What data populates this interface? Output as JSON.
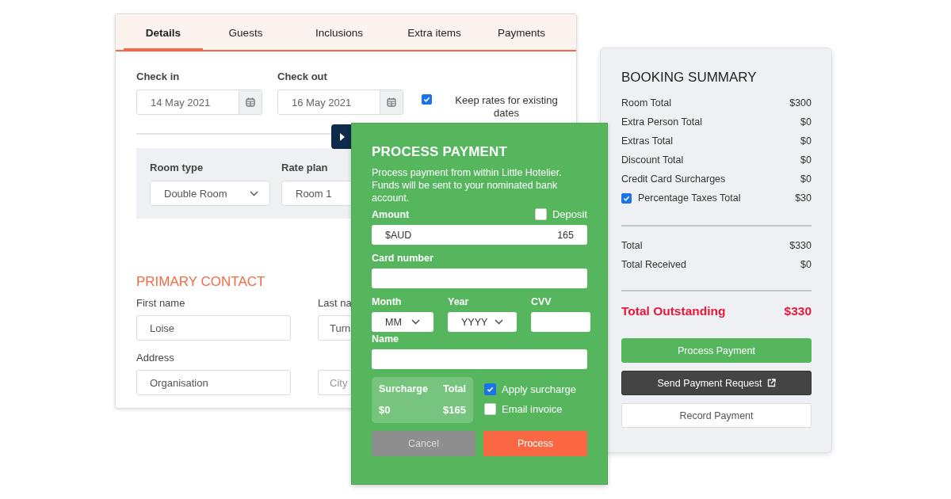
{
  "booking_form": {
    "tabs": [
      {
        "label": "Details",
        "selected": true
      },
      {
        "label": "Guests",
        "selected": false
      },
      {
        "label": "Inclusions",
        "selected": false
      },
      {
        "label": "Extra items",
        "selected": false
      },
      {
        "label": "Payments",
        "selected": false
      }
    ],
    "check_in": {
      "label": "Check in",
      "value": "14 May 2021"
    },
    "check_out": {
      "label": "Check out",
      "value": "16 May 2021"
    },
    "keep_rates": {
      "label": "Keep rates for existing dates",
      "checked": true
    },
    "room_type": {
      "label": "Room type",
      "value": "Double Room"
    },
    "rate_plan": {
      "label": "Rate plan",
      "value": "Room 1"
    },
    "primary_contact": {
      "title": "PRIMARY CONTACT",
      "first_name": {
        "label": "First name",
        "value": "Loise"
      },
      "last_name": {
        "label": "Last na",
        "value": "Turn"
      },
      "address": {
        "label": "Address",
        "value": "Organisation"
      },
      "city": {
        "placeholder": "City"
      }
    }
  },
  "payment_dialog": {
    "title": "PROCESS PAYMENT",
    "description": "Process payment from within Little Hotelier. Funds will be sent to your nominated bank account.",
    "amount": {
      "label": "Amount",
      "currency": "$AUD",
      "value": "165"
    },
    "deposit": {
      "label": "Deposit",
      "checked": false
    },
    "card_number": {
      "label": "Card number"
    },
    "month": {
      "label": "Month",
      "placeholder": "MM"
    },
    "year": {
      "label": "Year",
      "placeholder": "YYYY"
    },
    "cvv": {
      "label": "CVV"
    },
    "name": {
      "label": "Name"
    },
    "surcharge": {
      "surcharge_label": "Surcharge",
      "surcharge_value": "$0",
      "total_label": "Total",
      "total_value": "$165"
    },
    "options": [
      {
        "label": "Apply surcharge",
        "checked": true
      },
      {
        "label": "Email invoice",
        "checked": false
      }
    ],
    "buttons": [
      {
        "label": "Cancel",
        "kind": "secondary"
      },
      {
        "label": "Process",
        "kind": "primary"
      }
    ]
  },
  "booking_summary": {
    "title": "BOOKING SUMMARY",
    "lines": [
      {
        "label": "Room Total",
        "value": "$300"
      },
      {
        "label": "Extra Person Total",
        "value": "$0"
      },
      {
        "label": "Extras Total",
        "value": "$0"
      },
      {
        "label": "Discount Total",
        "value": "$0"
      },
      {
        "label": "Credit Card Surcharges",
        "value": "$0"
      }
    ],
    "taxes": {
      "label": "Percentage Taxes Total",
      "value": "$30",
      "checked": true
    },
    "totals": [
      {
        "label": "Total",
        "value": "$330"
      },
      {
        "label": "Total Received",
        "value": "$0"
      }
    ],
    "outstanding": {
      "label": "Total Outstanding",
      "value": "$330"
    },
    "buttons": [
      {
        "label": "Process Payment",
        "kind": "process"
      },
      {
        "label": "Send Payment Request",
        "kind": "request"
      },
      {
        "label": "Record Payment",
        "kind": "record"
      }
    ]
  }
}
